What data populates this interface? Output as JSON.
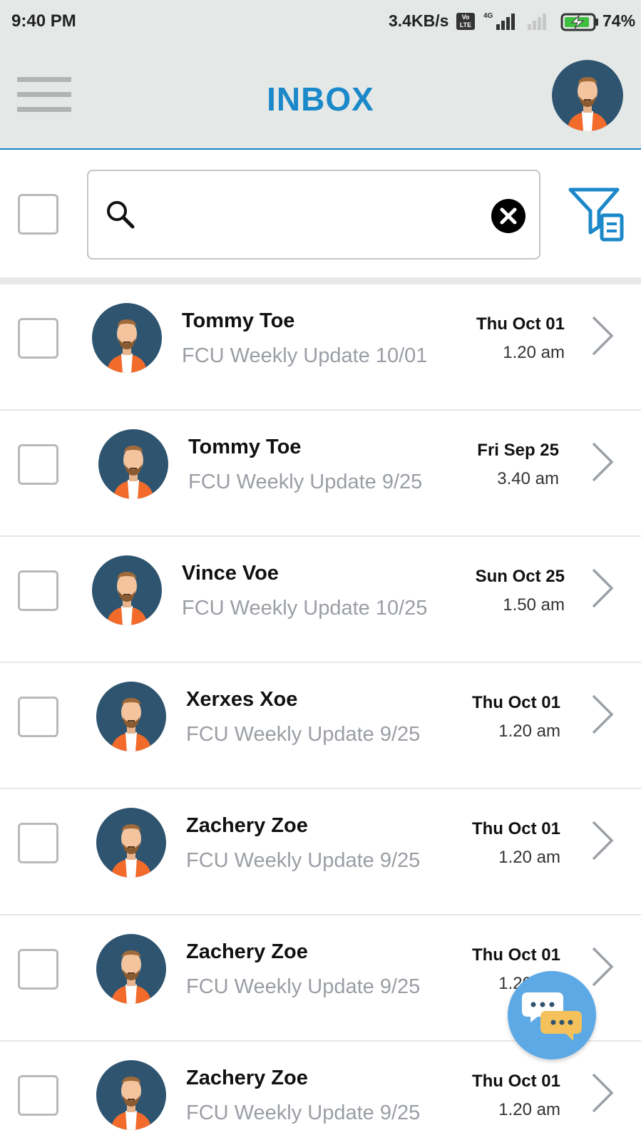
{
  "status_bar": {
    "time": "9:40 PM",
    "speed": "3.4KB/s",
    "volte": "Vo LTE",
    "network": "4G",
    "battery": "74%"
  },
  "header": {
    "title": "INBOX",
    "menu_icon": "hamburger-menu-icon",
    "profile_icon": "profile-avatar"
  },
  "search": {
    "placeholder": "",
    "value": "",
    "search_icon": "search-icon",
    "clear_icon": "clear-icon",
    "filter_icon": "filter-icon"
  },
  "messages": [
    {
      "sender": "Tommy Toe",
      "subject": "FCU Weekly Update 10/01",
      "date": "Thu Oct 01",
      "time": "1.20 am"
    },
    {
      "sender": "Tommy Toe",
      "subject": "FCU Weekly Update 9/25",
      "date": "Fri Sep 25",
      "time": "3.40 am"
    },
    {
      "sender": "Vince Voe",
      "subject": "FCU Weekly Update 10/25",
      "date": "Sun Oct 25",
      "time": "1.50 am"
    },
    {
      "sender": "Xerxes Xoe",
      "subject": "FCU Weekly Update 9/25",
      "date": "Thu Oct 01",
      "time": "1.20 am"
    },
    {
      "sender": "Zachery Zoe",
      "subject": "FCU Weekly Update 9/25",
      "date": "Thu Oct 01",
      "time": "1.20 am"
    },
    {
      "sender": "Zachery Zoe",
      "subject": "FCU Weekly Update 9/25",
      "date": "Thu Oct 01",
      "time": "1.20 am"
    },
    {
      "sender": "Zachery Zoe",
      "subject": "FCU Weekly Update 9/25",
      "date": "Thu Oct 01",
      "time": "1.20 am"
    }
  ],
  "chat_fab": {
    "icon": "chat-bubbles-icon"
  },
  "colors": {
    "accent": "#1a88c9",
    "header_bg": "#e4e8e7",
    "subject_gray": "#9a9ea4",
    "avatar_bg": "#2e5470",
    "shirt_orange": "#f26b2b",
    "chat_fab": "#5da9e5"
  }
}
